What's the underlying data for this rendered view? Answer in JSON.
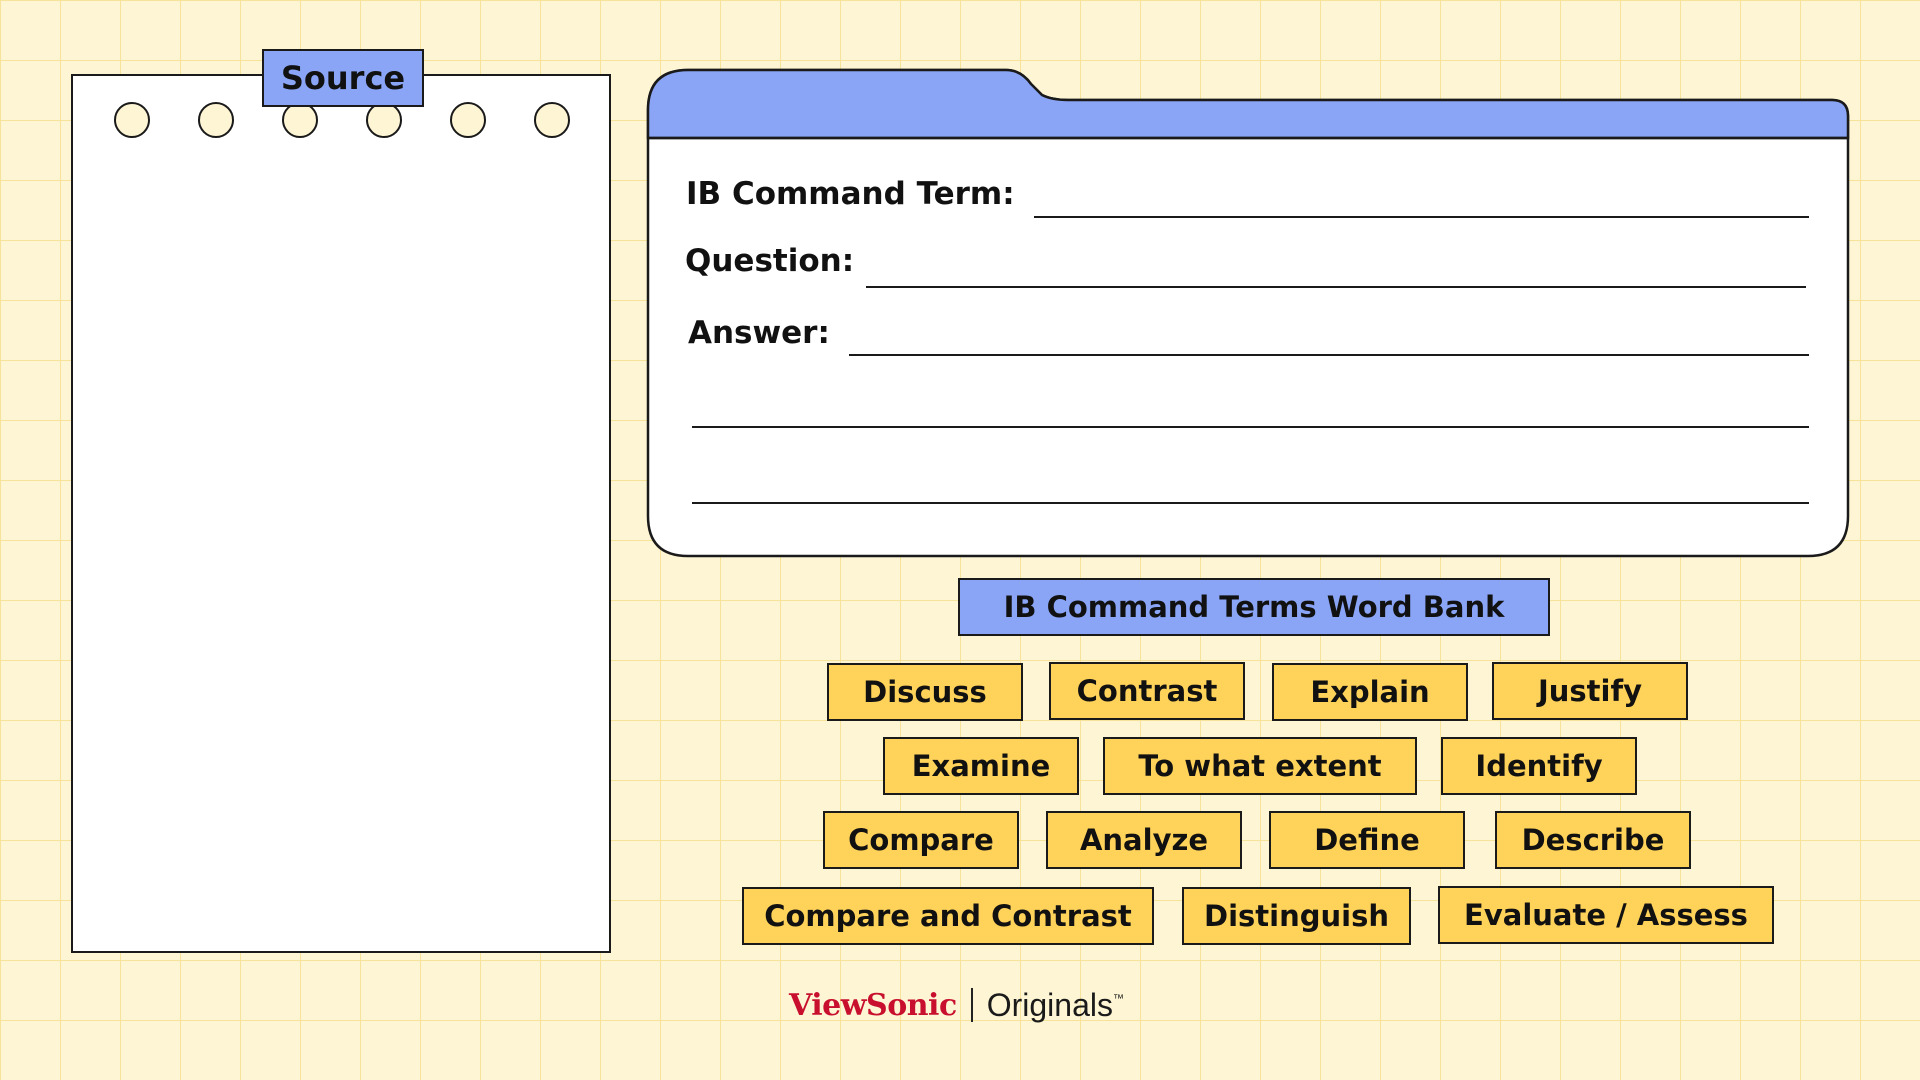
{
  "source": {
    "tab_label": "Source"
  },
  "worksheet": {
    "command_term_label": "IB Command Term:",
    "question_label": "Question:",
    "answer_label": "Answer:",
    "folder_tab_color": "#8aa5f6"
  },
  "word_bank": {
    "title": "IB Command Terms Word Bank",
    "terms": [
      "Discuss",
      "Contrast",
      "Explain",
      "Justify",
      "Examine",
      "To what extent",
      "Identify",
      "Compare",
      "Analyze",
      "Define",
      "Describe",
      "Compare and Contrast",
      "Distinguish",
      "Evaluate / Assess"
    ],
    "term_color": "#ffd25a"
  },
  "branding": {
    "brand": "ViewSonic",
    "product": "Originals",
    "tm": "™"
  }
}
